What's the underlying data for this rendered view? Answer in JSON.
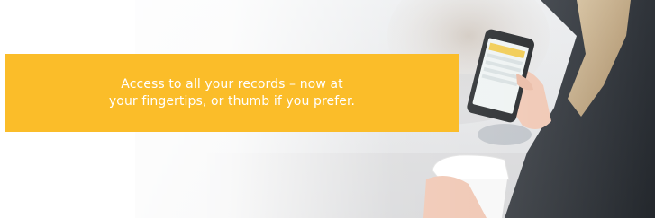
{
  "promo": {
    "line1": "Access to all your records – now at",
    "line2": "your fingertips, or thumb if you prefer."
  },
  "colors": {
    "accent": "#fbbd29",
    "text": "#ffffff"
  },
  "image": {
    "subject": "woman-holding-phone-and-coffee-cup"
  }
}
